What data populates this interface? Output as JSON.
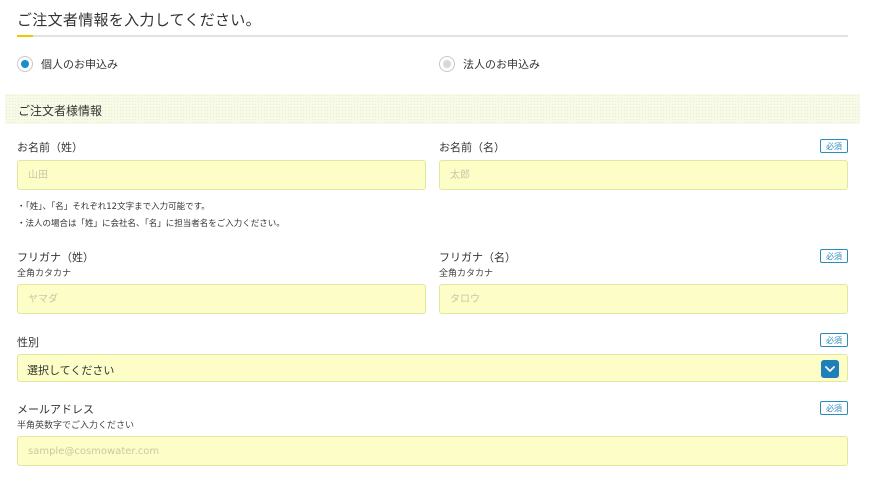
{
  "page_title": "ご注文者情報を入力してください。",
  "customer_type": {
    "options": [
      {
        "label": "個人のお申込み",
        "checked": true
      },
      {
        "label": "法人のお申込み",
        "checked": false
      }
    ]
  },
  "section_title": "ご注文者様情報",
  "required_label": "必須",
  "fields": {
    "last_name": {
      "label": "お名前（姓）",
      "placeholder": "山田",
      "value": ""
    },
    "first_name": {
      "label": "お名前（名）",
      "placeholder": "太郎",
      "value": ""
    },
    "name_notes": [
      "・「姓」、「名」それぞれ12文字まで入力可能です。",
      "・法人の場合は「姓」に会社名、「名」に担当者名をご入力ください。"
    ],
    "kana_last": {
      "label": "フリガナ（姓）",
      "sublabel": "全角カタカナ",
      "placeholder": "ヤマダ",
      "value": ""
    },
    "kana_first": {
      "label": "フリガナ（名）",
      "sublabel": "全角カタカナ",
      "placeholder": "タロウ",
      "value": ""
    },
    "gender": {
      "label": "性別",
      "selected": "選択してください"
    },
    "email": {
      "label": "メールアドレス",
      "sublabel": "半角英数字でご入力ください",
      "placeholder": "sample@cosmowater.com",
      "value": ""
    }
  },
  "colors": {
    "accent_blue": "#1f8ac9",
    "input_bg": "#fdfdc8",
    "title_accent": "#f2c700"
  }
}
